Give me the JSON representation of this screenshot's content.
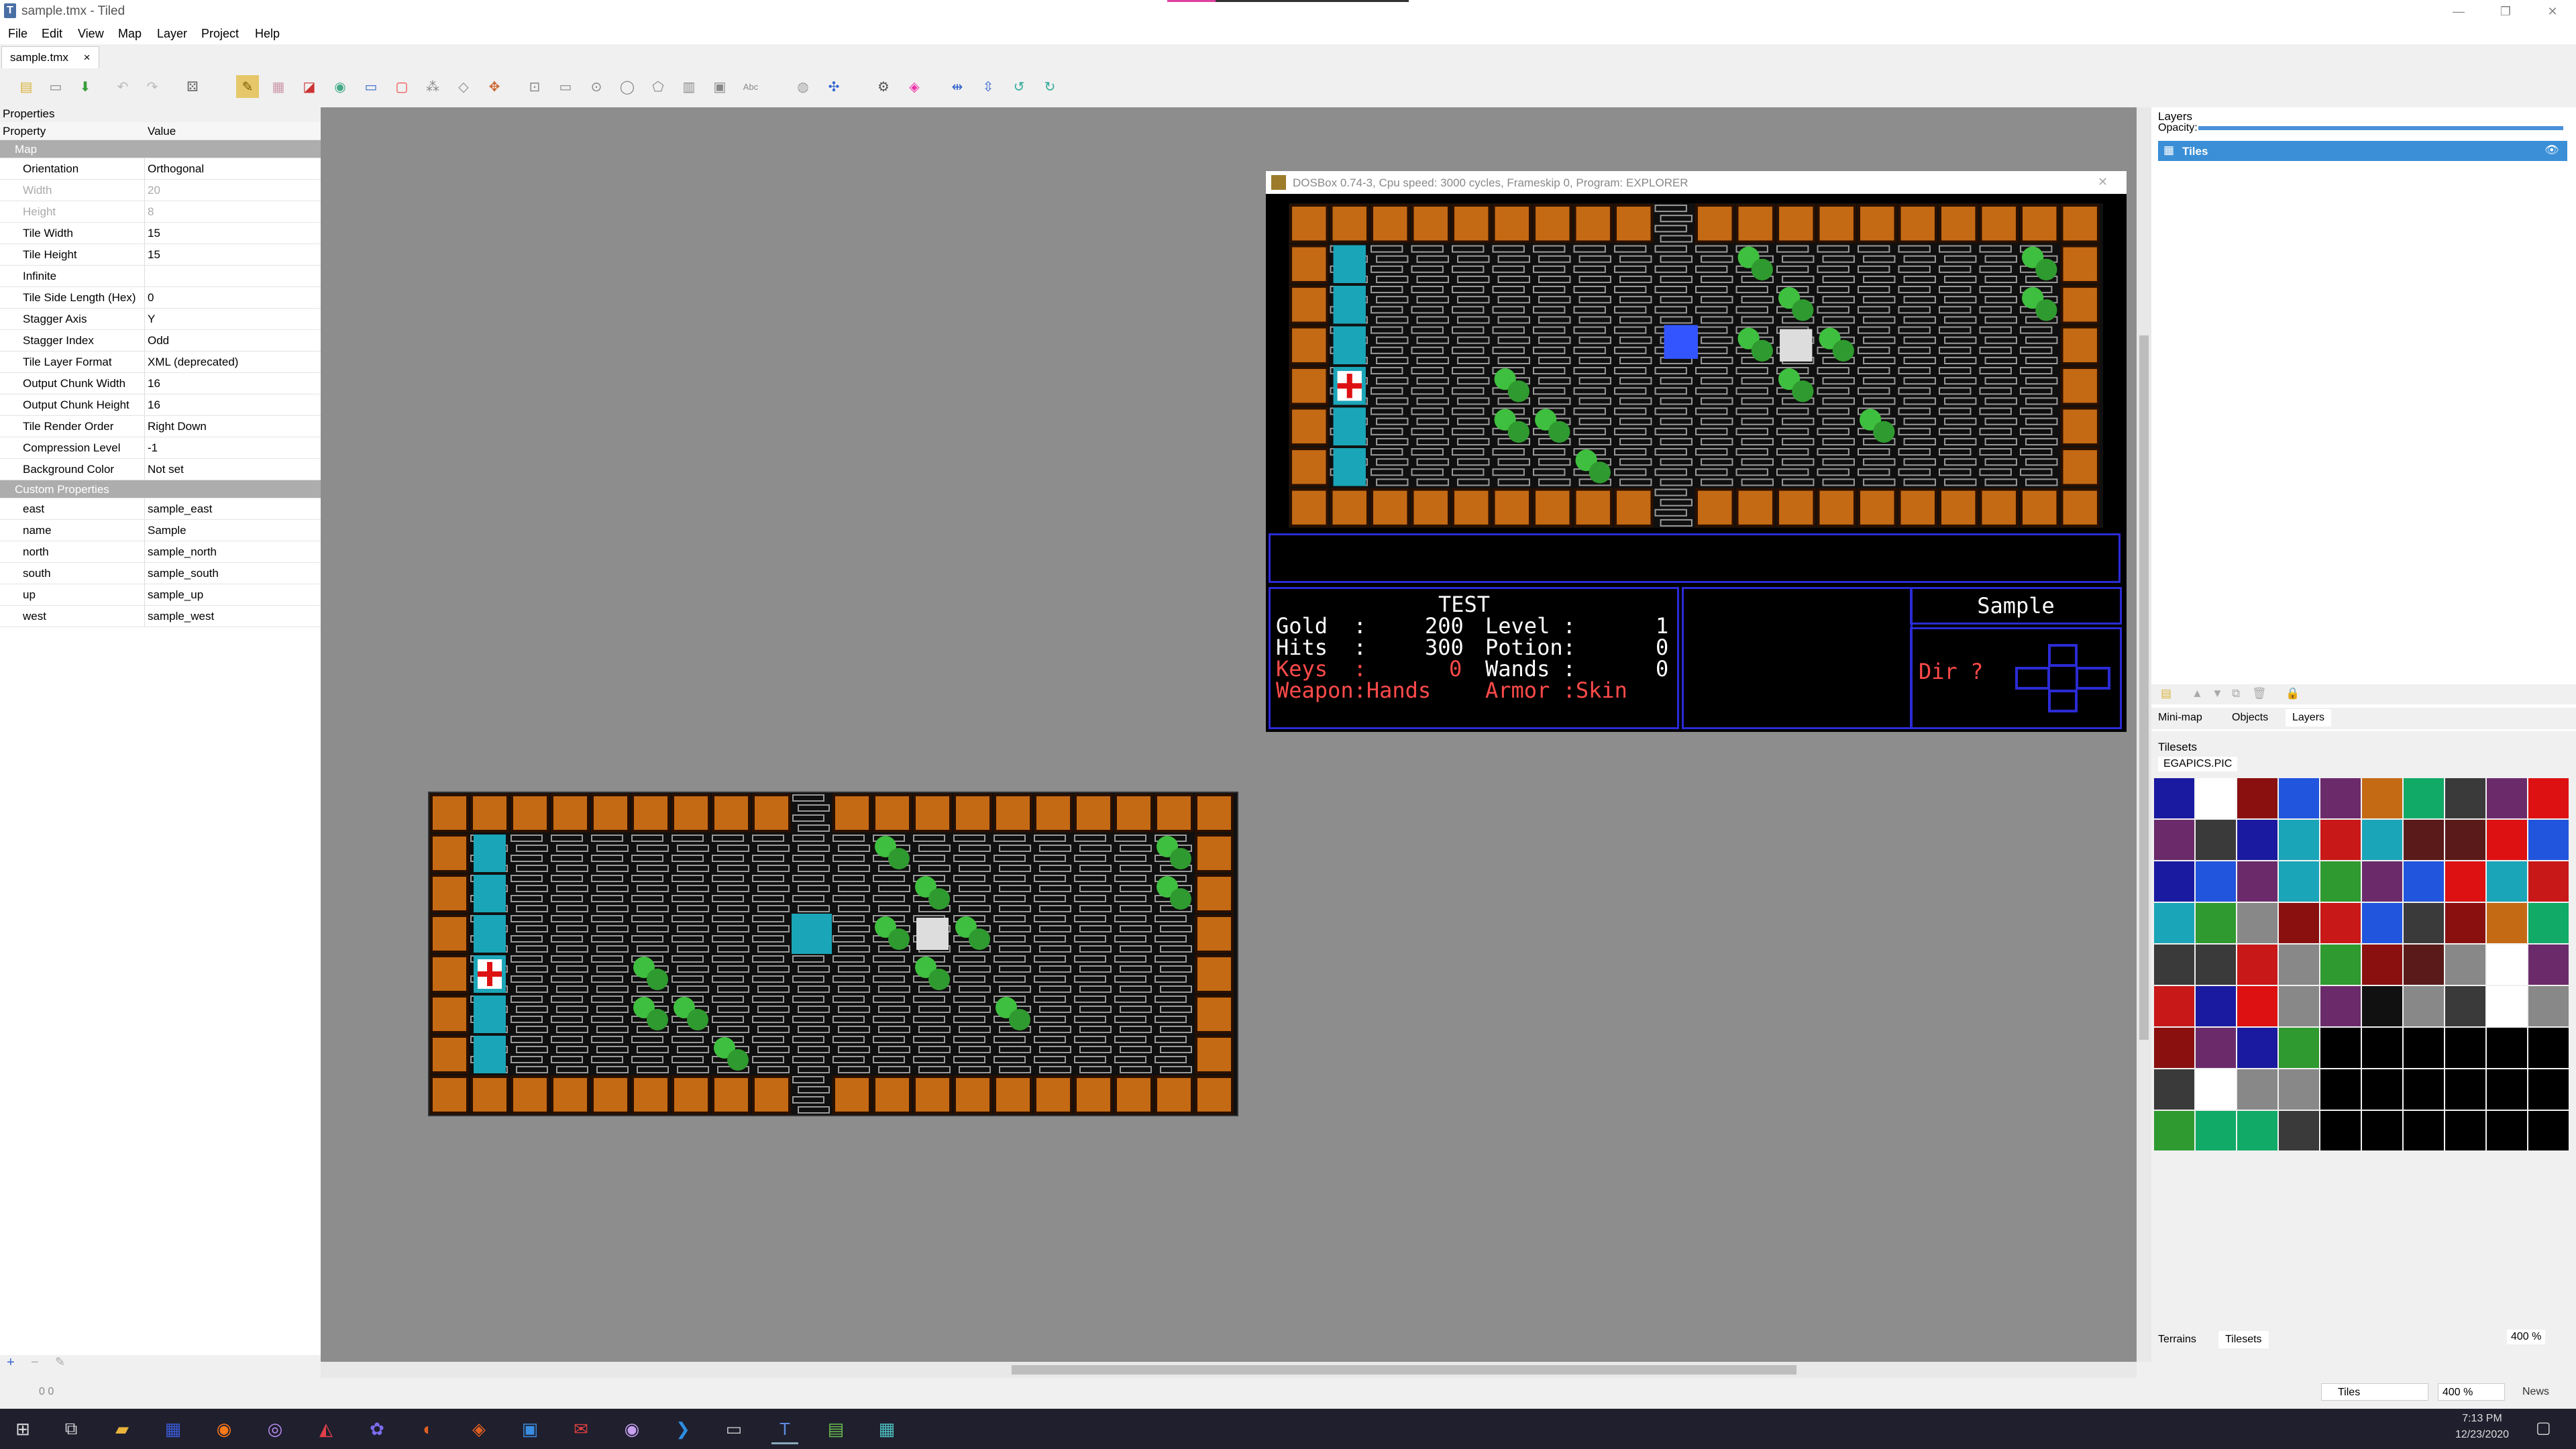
{
  "window": {
    "title": "sample.tmx - Tiled",
    "app_icon": "tiled-icon"
  },
  "menu": [
    "File",
    "Edit",
    "View",
    "Map",
    "Layer",
    "Project",
    "Help"
  ],
  "document_tab": {
    "label": "sample.tmx",
    "close": "×"
  },
  "properties": {
    "panel_title": "Properties",
    "header_property": "Property",
    "header_value": "Value",
    "group_map": "Map",
    "rows": [
      {
        "k": "Orientation",
        "v": "Orthogonal",
        "dim": false
      },
      {
        "k": "Width",
        "v": "20",
        "dim": true
      },
      {
        "k": "Height",
        "v": "8",
        "dim": true
      },
      {
        "k": "Tile Width",
        "v": "15",
        "dim": false
      },
      {
        "k": "Tile Height",
        "v": "15",
        "dim": false
      },
      {
        "k": "Infinite",
        "v": "",
        "dim": false
      },
      {
        "k": "Tile Side Length (Hex)",
        "v": "0",
        "dim": false
      },
      {
        "k": "Stagger Axis",
        "v": "Y",
        "dim": false
      },
      {
        "k": "Stagger Index",
        "v": "Odd",
        "dim": false
      },
      {
        "k": "Tile Layer Format",
        "v": "XML (deprecated)",
        "dim": false
      },
      {
        "k": "Output Chunk Width",
        "v": "16",
        "dim": false
      },
      {
        "k": "Output Chunk Height",
        "v": "16",
        "dim": false
      },
      {
        "k": "Tile Render Order",
        "v": "Right Down",
        "dim": false
      },
      {
        "k": "Compression Level",
        "v": "-1",
        "dim": false
      },
      {
        "k": "Background Color",
        "v": "Not set",
        "dim": false
      }
    ],
    "group_custom": "Custom Properties",
    "custom": [
      {
        "k": "east",
        "v": "sample_east"
      },
      {
        "k": "name",
        "v": "Sample"
      },
      {
        "k": "north",
        "v": "sample_north"
      },
      {
        "k": "south",
        "v": "sample_south"
      },
      {
        "k": "up",
        "v": "sample_up"
      },
      {
        "k": "west",
        "v": "sample_west"
      }
    ]
  },
  "dosbox": {
    "title": "DOSBox 0.74-3, Cpu speed:    3000 cycles, Frameskip  0, Program: EXPLORER",
    "player": "TEST",
    "location": "Sample",
    "stats": {
      "gold_label": "Gold  :",
      "gold": "200",
      "hits_label": "Hits  :",
      "hits": "300",
      "keys_label": "Keys  :",
      "keys": "0",
      "weapon_label": "Weapon:Hands",
      "level_label": "Level :",
      "level": "1",
      "potion_label": "Potion:",
      "potion": "0",
      "wands_label": "Wands :",
      "wands": "0",
      "armor_label": "Armor :Skin",
      "dir": "Dir ?"
    }
  },
  "layers": {
    "title": "Layers",
    "opacity_label": "Opacity:",
    "items": [
      {
        "name": "Tiles"
      }
    ],
    "tabs": [
      "Mini-map",
      "Objects",
      "Layers"
    ]
  },
  "tilesets": {
    "title": "Tilesets",
    "tab": "EGAPICS.PIC",
    "zoom": "400 %",
    "tabs": [
      "Terrains",
      "Tilesets"
    ]
  },
  "status": {
    "layer_select": "Tiles",
    "zoom": "400 %",
    "news": "News",
    "counts": "0  0"
  },
  "taskbar": {
    "time": "7:13 PM",
    "date": "12/23/2020"
  },
  "colors": {
    "brick": "#c46a15",
    "wall_blue": "#2b2bd6",
    "cyan": "#1ba5b8",
    "green": "#3fbf3f",
    "panel_grey": "#adadad"
  }
}
